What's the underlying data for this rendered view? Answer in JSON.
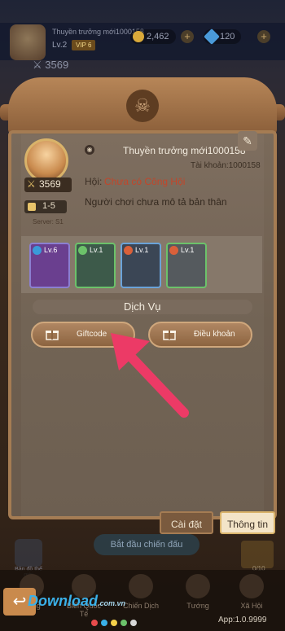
{
  "top": {
    "player_name": "Thuyền trưởng mới1000158",
    "level": "Lv.2",
    "vip": "VIP 6",
    "gold": "2,462",
    "gems": "120",
    "power": "3569"
  },
  "profile": {
    "name": "Thuyền trưởng mới1000158",
    "account": "Tài khoản:1000158",
    "guild_label": "Hội:",
    "guild_value": "Chưa có Công Hội",
    "description": "Người chơi chưa mô tả bản thân",
    "power": "3569",
    "level": "1-5",
    "server": "Server: S1"
  },
  "heroes": [
    {
      "level": "Lv.6",
      "border": "#8b7fd1",
      "bg": "#6a3f8f",
      "elem": "#3a9ad9"
    },
    {
      "level": "Lv.1",
      "border": "#6cc26a",
      "bg": "#3d5a4a",
      "elem": "#6cc26a"
    },
    {
      "level": "Lv.1",
      "border": "#6aa3d9",
      "bg": "#3b4655",
      "elem": "#d9603a"
    },
    {
      "level": "Lv.1",
      "border": "#6cc26a",
      "bg": "#555a5e",
      "elem": "#d9603a"
    }
  ],
  "services": {
    "title": "Dịch Vụ",
    "giftcode": "Giftcode",
    "terms": "Điều khoản"
  },
  "tabs": {
    "settings": "Cài đặt",
    "info": "Thông tin"
  },
  "background": {
    "start_battle": "Bắt đầu chiến đấu",
    "side_label": "Bản đồ thế giới",
    "chest_count": "0/10",
    "nav": [
      "Cảng",
      "Biển Quốc Tế",
      "Chiến Dịch",
      "Tướng",
      "Xã Hội"
    ]
  },
  "watermark": {
    "text": "Download",
    "tld": ".com.vn"
  },
  "dots": [
    "#e84b4b",
    "#3ab0e8",
    "#f3d04a",
    "#6cc26a",
    "#d8d8d8"
  ],
  "version": "App:1.0.9999"
}
